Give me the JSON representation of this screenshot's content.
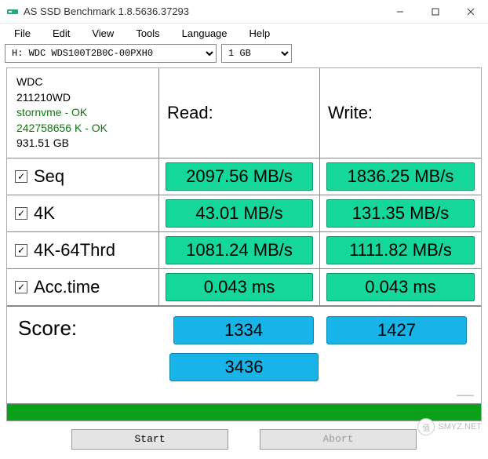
{
  "window": {
    "title": "AS SSD Benchmark 1.8.5636.37293"
  },
  "menu": {
    "file": "File",
    "edit": "Edit",
    "view": "View",
    "tools": "Tools",
    "language": "Language",
    "help": "Help"
  },
  "toolbar": {
    "drive": "H: WDC WDS100T2B0C-00PXH0",
    "size": "1 GB"
  },
  "info": {
    "model": "WDC",
    "model2": "211210WD",
    "driver": "stornvme - OK",
    "align": "242758656 K - OK",
    "capacity": "931.51 GB"
  },
  "headers": {
    "read": "Read:",
    "write": "Write:"
  },
  "rows": {
    "seq": {
      "label": "Seq",
      "read": "2097.56 MB/s",
      "write": "1836.25 MB/s"
    },
    "k4": {
      "label": "4K",
      "read": "43.01 MB/s",
      "write": "131.35 MB/s"
    },
    "k4_64": {
      "label": "4K-64Thrd",
      "read": "1081.24 MB/s",
      "write": "1111.82 MB/s"
    },
    "acc": {
      "label": "Acc.time",
      "read": "0.043 ms",
      "write": "0.043 ms"
    }
  },
  "score": {
    "label": "Score:",
    "read": "1334",
    "write": "1427",
    "total": "3436"
  },
  "buttons": {
    "start": "Start",
    "abort": "Abort"
  },
  "watermark": {
    "text": "SMYZ.NET",
    "badge": "值"
  }
}
